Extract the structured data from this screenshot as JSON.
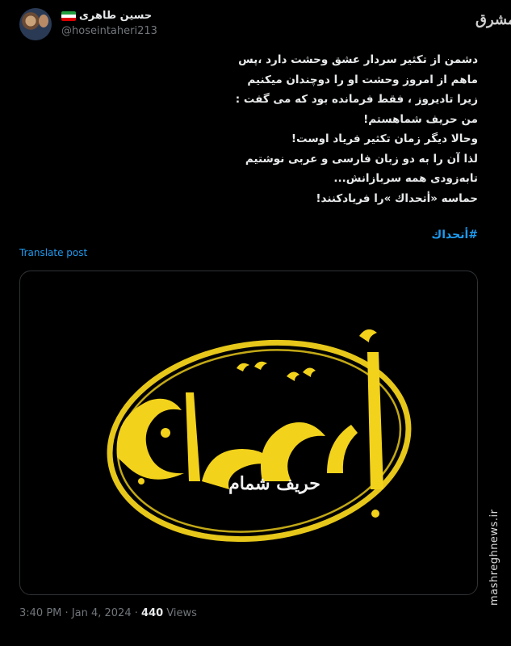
{
  "author": {
    "display_name": "حسین طاهری",
    "handle": "@hoseintaheri213",
    "flag_colors": [
      "#239f40",
      "#ffffff",
      "#da0000"
    ]
  },
  "watermark": {
    "logo_text": "مشرق",
    "site": "mashreghnews.ir"
  },
  "post": {
    "lines": [
      "دشمن از تکثیر سردار عشق وحشت دارد ،پس",
      "ماهم از امروز  وحشت او را دوچندان میکنیم",
      "زیرا تادیروز ، فقط فرمانده بود که می گفت :",
      "من حریف شماهستم!",
      "وحالا دیگر زمان تکثیر فریاد اوست!",
      "لذا آن را به دو زبان فارسی و عربی نوشتیم",
      "تابه‌زودی همه سربازانش...",
      "حماسه «أتحداك »را فریادکنند!"
    ],
    "hashtag": "#أتحداك",
    "translate_label": "Translate post"
  },
  "media": {
    "main_text": "أتحداك",
    "sub_text": "حریف شمام",
    "accent_color": "#f2d21b"
  },
  "meta": {
    "time": "3:40 PM",
    "separator": "·",
    "date": "Jan 4, 2024",
    "views_count": "440",
    "views_label": "Views"
  }
}
